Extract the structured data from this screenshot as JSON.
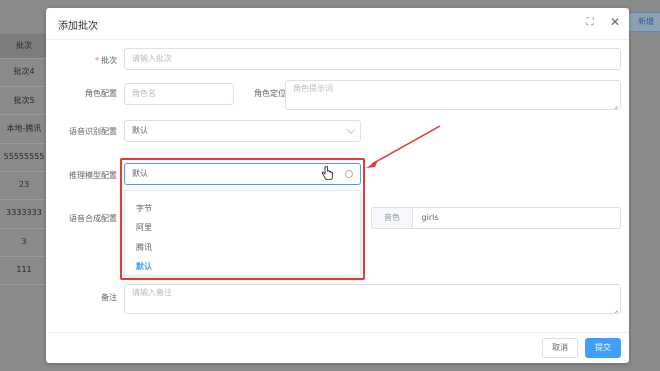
{
  "background": {
    "header": "批次",
    "rows": [
      "批次4",
      "批次5",
      "本地-腾讯",
      "55555555",
      "23",
      "3333333",
      "3",
      "111"
    ],
    "new_button": "新增"
  },
  "dialog": {
    "title": "添加批次",
    "fields": {
      "batch": {
        "label": "批次",
        "placeholder": "请输入批次"
      },
      "role_config": {
        "label": "角色配置",
        "placeholder": "角色名"
      },
      "role_position": {
        "label": "角色定位",
        "placeholder": "角色提示词"
      },
      "asr_config": {
        "label": "语音识别配置",
        "value": "默认"
      },
      "llm_config": {
        "label": "推理模型配置",
        "value": "默认"
      },
      "tts_config": {
        "label": "语音合成配置",
        "voice_label": "音色",
        "voice_value": "girls"
      },
      "remark": {
        "label": "备注",
        "placeholder": "请输入备注"
      }
    },
    "dropdown_options": [
      "字节",
      "阿里",
      "腾讯",
      "默认"
    ],
    "selected_option": "默认",
    "buttons": {
      "cancel": "取消",
      "submit": "提交"
    }
  },
  "colors": {
    "accent": "#409eff",
    "highlight": "#e53935",
    "required": "#f56c6c"
  },
  "icons": [
    "expand-icon",
    "close-icon",
    "chevron-down-icon",
    "pointer-cursor-icon",
    "clear-circle-icon"
  ]
}
